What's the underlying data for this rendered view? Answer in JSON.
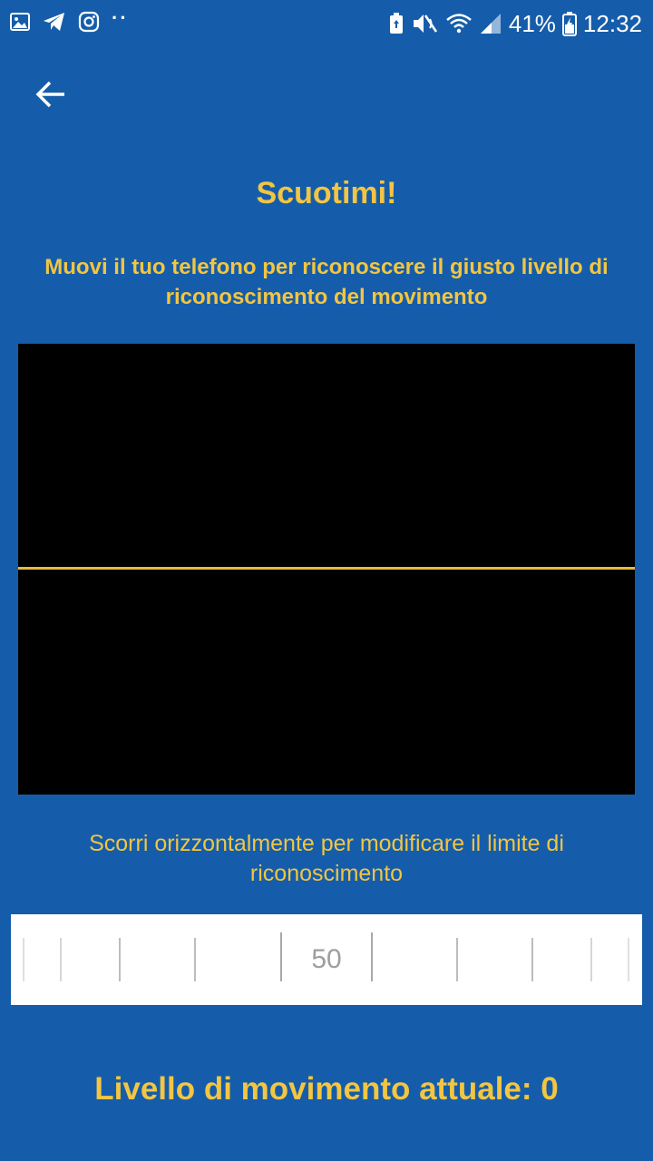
{
  "status_bar": {
    "left_icons": [
      "image-icon",
      "telegram-icon",
      "instagram-icon"
    ],
    "overflow_dots": "··",
    "battery_percent": "41%",
    "time": "12:32"
  },
  "header": {
    "back_icon": "arrow-left-icon"
  },
  "main": {
    "title": "Scuotimi!",
    "instructions": "Muovi il tuo telefono per riconoscere il giusto livello di riconoscimento del movimento",
    "hint": "Scorri orizzontalmente per modificare il limite di riconoscimento",
    "threshold_value": "50",
    "current_level": "Livello di movimento attuale: 0"
  },
  "colors": {
    "background": "#155DAA",
    "accent": "#F2C542",
    "graph_line": "#E9B83E",
    "graph_background": "#000000"
  }
}
